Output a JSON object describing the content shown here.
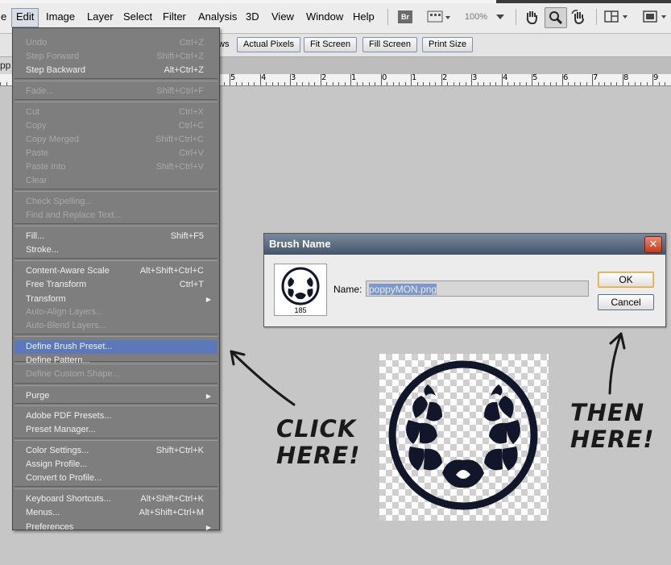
{
  "menubar": {
    "items": [
      "e",
      "Edit",
      "Image",
      "Layer",
      "Select",
      "Filter",
      "Analysis",
      "3D",
      "View",
      "Window",
      "Help"
    ],
    "bridge_label": "Br",
    "zoom": "100%"
  },
  "options_bar": {
    "partial_label": "ws",
    "buttons": [
      "Actual Pixels",
      "Fit Screen",
      "Fill Screen",
      "Print Size"
    ]
  },
  "document": {
    "tab_label": "pp"
  },
  "ruler": {
    "labels": [
      "5",
      "4",
      "3",
      "2",
      "1",
      "0",
      "1",
      "2",
      "3",
      "4",
      "5",
      "6",
      "7",
      "8",
      "9"
    ]
  },
  "edit_menu": {
    "items": [
      {
        "label": "Undo",
        "shortcut": "Ctrl+Z",
        "enabled": false
      },
      {
        "label": "Step Forward",
        "shortcut": "Shift+Ctrl+Z",
        "enabled": false
      },
      {
        "label": "Step Backward",
        "shortcut": "Alt+Ctrl+Z",
        "enabled": true
      },
      {
        "label": "Fade...",
        "shortcut": "Shift+Ctrl+F",
        "enabled": false
      },
      {
        "label": "Cut",
        "shortcut": "Ctrl+X",
        "enabled": false
      },
      {
        "label": "Copy",
        "shortcut": "Ctrl+C",
        "enabled": false
      },
      {
        "label": "Copy Merged",
        "shortcut": "Shift+Ctrl+C",
        "enabled": false
      },
      {
        "label": "Paste",
        "shortcut": "Ctrl+V",
        "enabled": false
      },
      {
        "label": "Paste Into",
        "shortcut": "Shift+Ctrl+V",
        "enabled": false
      },
      {
        "label": "Clear",
        "shortcut": "",
        "enabled": false
      },
      {
        "label": "Check Spelling...",
        "shortcut": "",
        "enabled": false
      },
      {
        "label": "Find and Replace Text...",
        "shortcut": "",
        "enabled": false
      },
      {
        "label": "Fill...",
        "shortcut": "Shift+F5",
        "enabled": true
      },
      {
        "label": "Stroke...",
        "shortcut": "",
        "enabled": true
      },
      {
        "label": "Content-Aware Scale",
        "shortcut": "Alt+Shift+Ctrl+C",
        "enabled": true
      },
      {
        "label": "Free Transform",
        "shortcut": "Ctrl+T",
        "enabled": true
      },
      {
        "label": "Transform",
        "shortcut": "",
        "enabled": true,
        "submenu": true
      },
      {
        "label": "Auto-Align Layers...",
        "shortcut": "",
        "enabled": false
      },
      {
        "label": "Auto-Blend Layers...",
        "shortcut": "",
        "enabled": false
      },
      {
        "label": "Define Brush Preset...",
        "shortcut": "",
        "enabled": true,
        "highlighted": true
      },
      {
        "label": "Define Pattern...",
        "shortcut": "",
        "enabled": true
      },
      {
        "label": "Define Custom Shape...",
        "shortcut": "",
        "enabled": false
      },
      {
        "label": "Purge",
        "shortcut": "",
        "enabled": true,
        "submenu": true
      },
      {
        "label": "Adobe PDF Presets...",
        "shortcut": "",
        "enabled": true
      },
      {
        "label": "Preset Manager...",
        "shortcut": "",
        "enabled": true
      },
      {
        "label": "Color Settings...",
        "shortcut": "Shift+Ctrl+K",
        "enabled": true
      },
      {
        "label": "Assign Profile...",
        "shortcut": "",
        "enabled": true
      },
      {
        "label": "Convert to Profile...",
        "shortcut": "",
        "enabled": true
      },
      {
        "label": "Keyboard Shortcuts...",
        "shortcut": "Alt+Shift+Ctrl+K",
        "enabled": true
      },
      {
        "label": "Menus...",
        "shortcut": "Alt+Shift+Ctrl+M",
        "enabled": true
      },
      {
        "label": "Preferences",
        "shortcut": "",
        "enabled": true,
        "submenu": true
      }
    ]
  },
  "dialog": {
    "title": "Brush Name",
    "brush_size": "185",
    "name_label": "Name:",
    "name_value": "poppyMON.png",
    "ok_label": "OK",
    "cancel_label": "Cancel"
  },
  "annotations": {
    "click_here": [
      "CLICK",
      "HERE!"
    ],
    "then_here": [
      "THEN",
      "HERE!"
    ]
  },
  "colors": {
    "menu_bg": "#7e7e7e",
    "menu_highlight": "#5b79b8",
    "canvas_bg": "#c6c6c6",
    "dialog_title": "#44546a"
  }
}
